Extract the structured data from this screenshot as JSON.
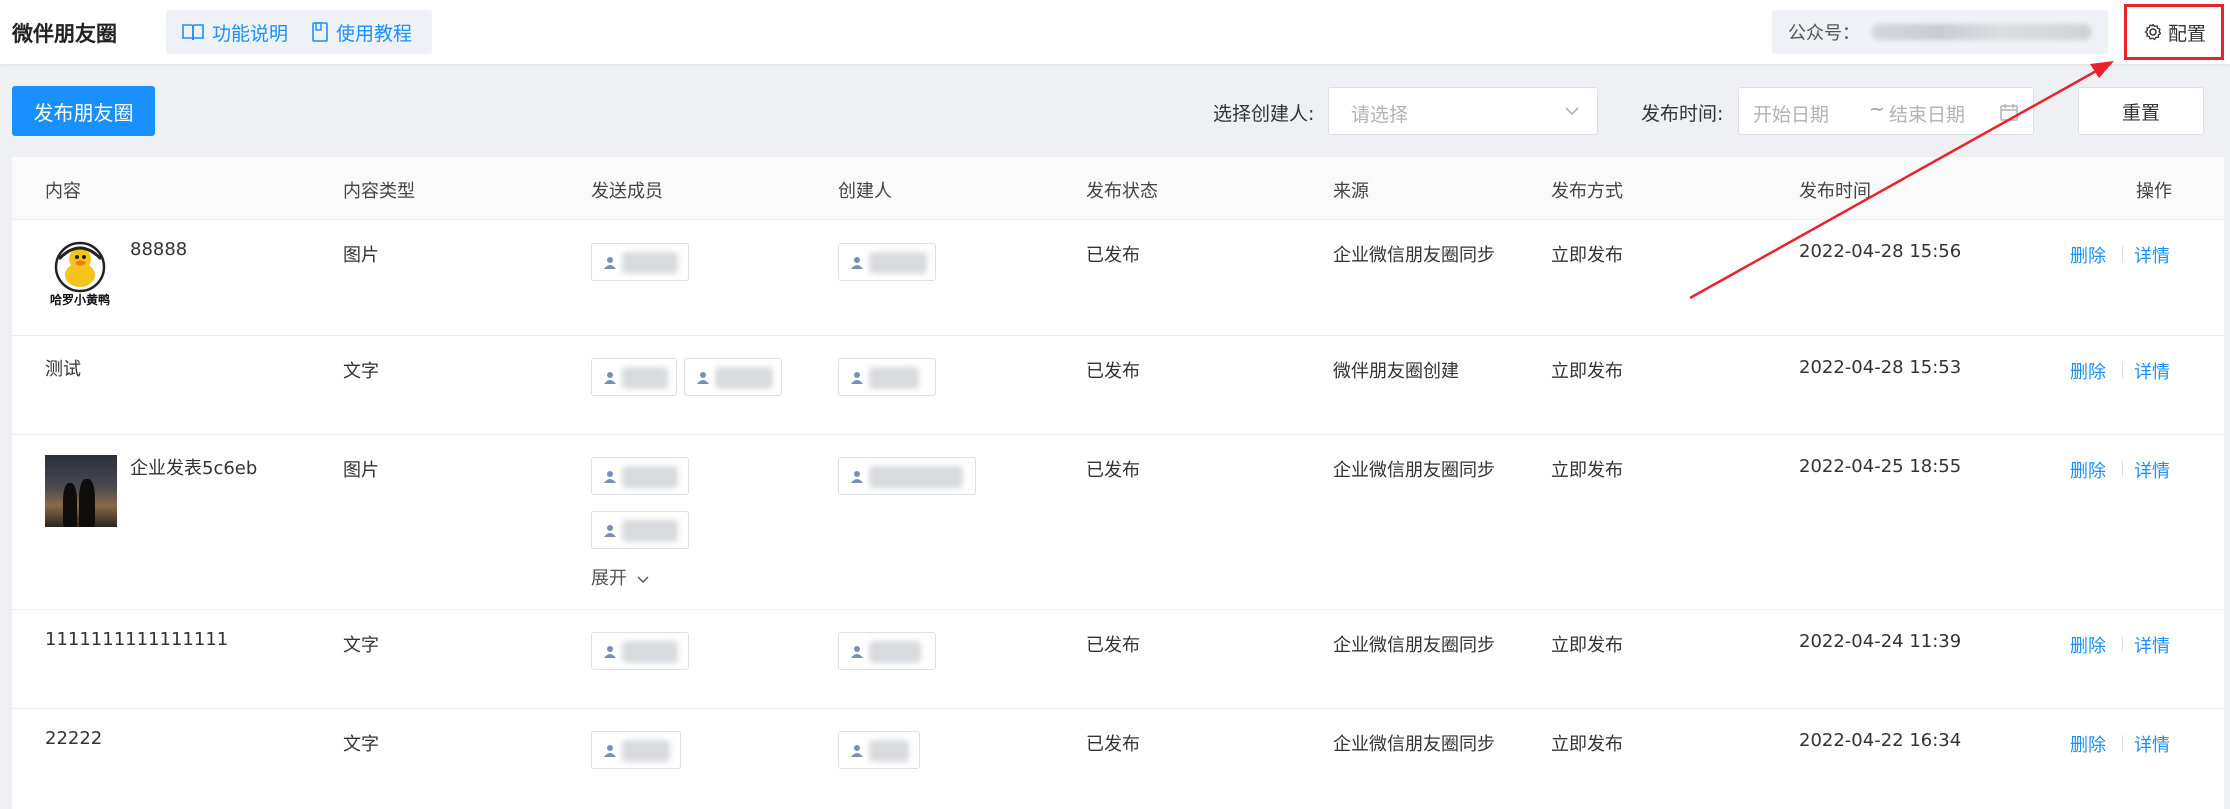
{
  "header": {
    "app_title": "微伴朋友圈",
    "help_links": [
      {
        "label": "功能说明",
        "icon": "book-icon"
      },
      {
        "label": "使用教程",
        "icon": "document-icon"
      }
    ],
    "account_label": "公众号：",
    "config_label": "配置",
    "config_icon": "gear-icon"
  },
  "toolbar": {
    "publish_label": "发布朋友圈",
    "creator_label": "选择创建人:",
    "creator_placeholder": "请选择",
    "time_label": "发布时间:",
    "date_start_placeholder": "开始日期",
    "date_separator": "~",
    "date_end_placeholder": "结束日期",
    "reset_label": "重置"
  },
  "table": {
    "columns": [
      "内容",
      "内容类型",
      "发送成员",
      "创建人",
      "发布状态",
      "来源",
      "发布方式",
      "发布时间",
      "操作"
    ],
    "rows": [
      {
        "content": "88888",
        "thumbnail": "duck-logo",
        "type": "图片",
        "status": "已发布",
        "source": "企业微信朋友圈同步",
        "method": "立即发布",
        "time": "2022-04-28 15:56"
      },
      {
        "content": "测试",
        "thumbnail": "",
        "type": "文字",
        "status": "已发布",
        "source": "微伴朋友圈创建",
        "method": "立即发布",
        "time": "2022-04-28 15:53"
      },
      {
        "content": "企业发表5c6eb",
        "thumbnail": "photo",
        "type": "图片",
        "status": "已发布",
        "source": "企业微信朋友圈同步",
        "method": "立即发布",
        "time": "2022-04-25 18:55",
        "expand_label": "展开"
      },
      {
        "content": "1111111111111111",
        "thumbnail": "",
        "type": "文字",
        "status": "已发布",
        "source": "企业微信朋友圈同步",
        "method": "立即发布",
        "time": "2022-04-24 11:39"
      },
      {
        "content": "22222",
        "thumbnail": "",
        "type": "文字",
        "status": "已发布",
        "source": "企业微信朋友圈同步",
        "method": "立即发布",
        "time": "2022-04-22 16:34"
      }
    ],
    "actions": {
      "delete": "删除",
      "detail": "详情"
    }
  },
  "logo_text": {
    "line1": "哈罗小黄鸭"
  },
  "colors": {
    "primary": "#1890ff",
    "annotation": "#e8232b"
  }
}
